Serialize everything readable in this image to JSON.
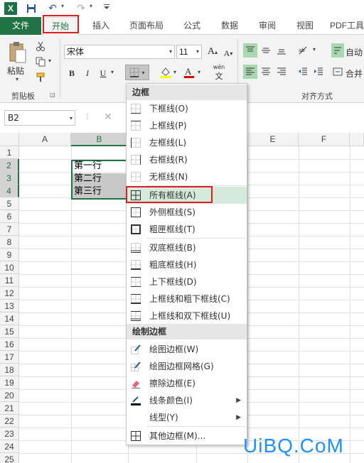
{
  "quick_access": {
    "excel_logo": "X",
    "dropdown": "▾"
  },
  "tabs": [
    {
      "label": "文件"
    },
    {
      "label": "开始"
    },
    {
      "label": "插入"
    },
    {
      "label": "页面布局"
    },
    {
      "label": "公式"
    },
    {
      "label": "数据"
    },
    {
      "label": "审阅"
    },
    {
      "label": "视图"
    },
    {
      "label": "PDF工具"
    }
  ],
  "ribbon": {
    "paste_label": "粘贴",
    "clipboard_group": "剪贴板",
    "font_name": "宋体",
    "font_size": "11",
    "bold": "B",
    "italic": "I",
    "underline": "U",
    "wrap_text": "自动",
    "merge": "合并",
    "align_group": "对齐方式",
    "phonetic": "wén"
  },
  "formula_bar": {
    "name_box": "B2"
  },
  "sheet": {
    "columns": [
      "A",
      "B",
      "C",
      "D",
      "E",
      "F"
    ],
    "rows": [
      "1",
      "2",
      "3",
      "4",
      "5",
      "6",
      "7",
      "8",
      "9",
      "10",
      "11",
      "12",
      "13",
      "14",
      "15",
      "16",
      "17",
      "18",
      "19",
      "20",
      "21",
      "22",
      "23",
      "24",
      "25"
    ],
    "cells": [
      {
        "ref": "B2",
        "text": "第一行"
      },
      {
        "ref": "B3",
        "text": "第二行"
      },
      {
        "ref": "B4",
        "text": "第三行"
      }
    ]
  },
  "menu": {
    "section_borders": "边框",
    "section_draw": "绘制边框",
    "items": [
      {
        "label": "下框线(O)",
        "icon": "border-bottom-icon"
      },
      {
        "label": "上框线(P)",
        "icon": "border-top-icon"
      },
      {
        "label": "左框线(L)",
        "icon": "border-left-icon"
      },
      {
        "label": "右框线(R)",
        "icon": "border-right-icon"
      },
      {
        "label": "无框线(N)",
        "icon": "border-none-icon"
      },
      {
        "label": "所有框线(A)",
        "icon": "border-all-icon"
      },
      {
        "label": "外侧框线(S)",
        "icon": "border-outside-icon"
      },
      {
        "label": "粗匣框线(T)",
        "icon": "border-thick-box-icon"
      },
      {
        "label": "双底框线(B)",
        "icon": "border-double-bottom-icon"
      },
      {
        "label": "粗底框线(H)",
        "icon": "border-thick-bottom-icon"
      },
      {
        "label": "上下框线(D)",
        "icon": "border-top-bottom-icon"
      },
      {
        "label": "上框线和粗下框线(C)",
        "icon": "border-top-thick-bottom-icon"
      },
      {
        "label": "上框线和双下框线(U)",
        "icon": "border-top-double-bottom-icon"
      }
    ],
    "draw_items": [
      {
        "label": "绘图边框(W)",
        "icon": "draw-border-icon"
      },
      {
        "label": "绘图边框网格(G)",
        "icon": "draw-border-grid-icon"
      },
      {
        "label": "擦除边框(E)",
        "icon": "eraser-icon"
      },
      {
        "label": "线条颜色(I)",
        "icon": "line-color-icon"
      },
      {
        "label": "线型(Y)",
        "icon": "line-style-icon"
      },
      {
        "label": "其他边框(M)...",
        "icon": "more-borders-icon"
      }
    ]
  },
  "watermark": "UiBQ.CoM",
  "colors": {
    "excel_green": "#217346",
    "highlight_red": "#e02020",
    "menu_highlight": "#d6eadb"
  }
}
